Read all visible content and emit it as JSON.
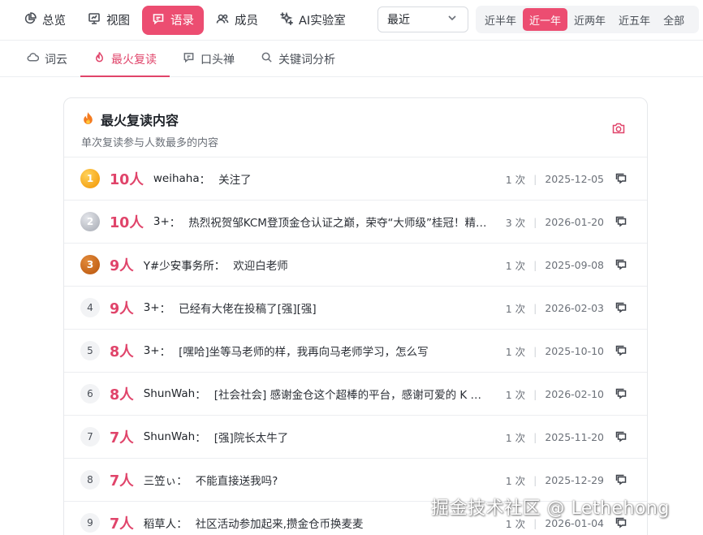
{
  "topnav": {
    "items": [
      {
        "label": "总览",
        "icon": "pie-chart-icon",
        "active": false
      },
      {
        "label": "视图",
        "icon": "monitor-icon",
        "active": false
      },
      {
        "label": "语录",
        "icon": "chat-bubble-icon",
        "active": true
      },
      {
        "label": "成员",
        "icon": "users-icon",
        "active": false
      },
      {
        "label": "AI实验室",
        "icon": "sparkles-icon",
        "active": false
      }
    ],
    "range_select": {
      "value": "最近",
      "icon": "chevron-down-icon"
    },
    "periods": [
      {
        "label": "近半年",
        "active": false
      },
      {
        "label": "近一年",
        "active": true
      },
      {
        "label": "近两年",
        "active": false
      },
      {
        "label": "近五年",
        "active": false
      },
      {
        "label": "全部",
        "active": false
      }
    ]
  },
  "subtabs": [
    {
      "label": "词云",
      "icon": "cloud-icon",
      "active": false
    },
    {
      "label": "最火复读",
      "icon": "fire-icon",
      "active": true
    },
    {
      "label": "口头禅",
      "icon": "message-square-icon",
      "active": false
    },
    {
      "label": "关键词分析",
      "icon": "search-icon",
      "active": false
    }
  ],
  "card": {
    "title": "最火复读内容",
    "title_icon": "flame-icon",
    "subtitle": "单次复读参与人数最多的内容",
    "action_icon": "camera-icon",
    "rows": [
      {
        "rank": "1",
        "people": "10人",
        "speaker": "weihaha",
        "content": "关注了",
        "count": "1 次",
        "date": "2025-12-05"
      },
      {
        "rank": "2",
        "people": "10人",
        "speaker": "3+",
        "content": "热烈祝贺邹KCM登顶金仓认证之巅，荣夺“大师级”桂冠！精湛的技艺铸就卓越，",
        "count": "3 次",
        "date": "2026-01-20"
      },
      {
        "rank": "3",
        "people": "9人",
        "speaker": "Y#少安事务所",
        "content": "欢迎白老师",
        "count": "1 次",
        "date": "2025-09-08"
      },
      {
        "rank": "4",
        "people": "9人",
        "speaker": "3+",
        "content": "已经有大佬在投稿了[强][强]",
        "count": "1 次",
        "date": "2026-02-03"
      },
      {
        "rank": "5",
        "people": "8人",
        "speaker": "3+",
        "content": "[嘿哈]坐等马老师的样，我再向马老师学习，怎么写",
        "count": "1 次",
        "date": "2025-10-10"
      },
      {
        "rank": "6",
        "people": "8人",
        "speaker": "ShunWah",
        "content": "[社会社会] 感谢金仓这个超棒的平台，感谢可爱的 K 宝，感谢各位大佬",
        "count": "1 次",
        "date": "2026-02-10"
      },
      {
        "rank": "7",
        "people": "7人",
        "speaker": "ShunWah",
        "content": "[强]院长太牛了",
        "count": "1 次",
        "date": "2025-11-20"
      },
      {
        "rank": "8",
        "people": "7人",
        "speaker": "三笠ぃ",
        "content": "不能直接送我吗?",
        "count": "1 次",
        "date": "2025-12-29"
      },
      {
        "rank": "9",
        "people": "7人",
        "speaker": "稻草人",
        "content": "社区活动参加起来,攒金仓币换麦麦",
        "count": "1 次",
        "date": "2026-01-04"
      }
    ]
  },
  "watermark": "掘金技术社区 @ Lethehong",
  "colors": {
    "accent": "#ec4d71",
    "accent_text": "#e0446a",
    "gold": "#f29400",
    "silver": "#a5a9b2",
    "bronze": "#b8540c"
  }
}
